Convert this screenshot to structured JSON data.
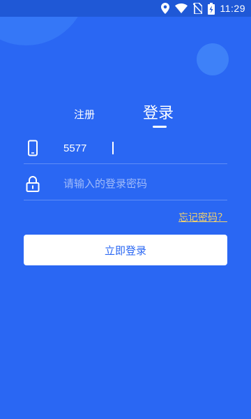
{
  "status_bar": {
    "time": "11:29",
    "icons": [
      "location-icon",
      "wifi-icon",
      "no-sim-icon",
      "battery-icon"
    ]
  },
  "tabs": {
    "register": "注册",
    "login": "登录",
    "active": "login"
  },
  "form": {
    "phone": {
      "icon": "phone-icon",
      "value": "5577",
      "placeholder": ""
    },
    "password": {
      "icon": "lock-icon",
      "value": "",
      "placeholder": "请输入的登录密码"
    }
  },
  "forgot_password": "忘记密码？",
  "login_button": "立即登录",
  "colors": {
    "background": "#2a67f3",
    "status_bar": "#1f58d6",
    "button_bg": "#ffffff",
    "button_text": "#2a67f3",
    "link": "#f2d16b"
  }
}
